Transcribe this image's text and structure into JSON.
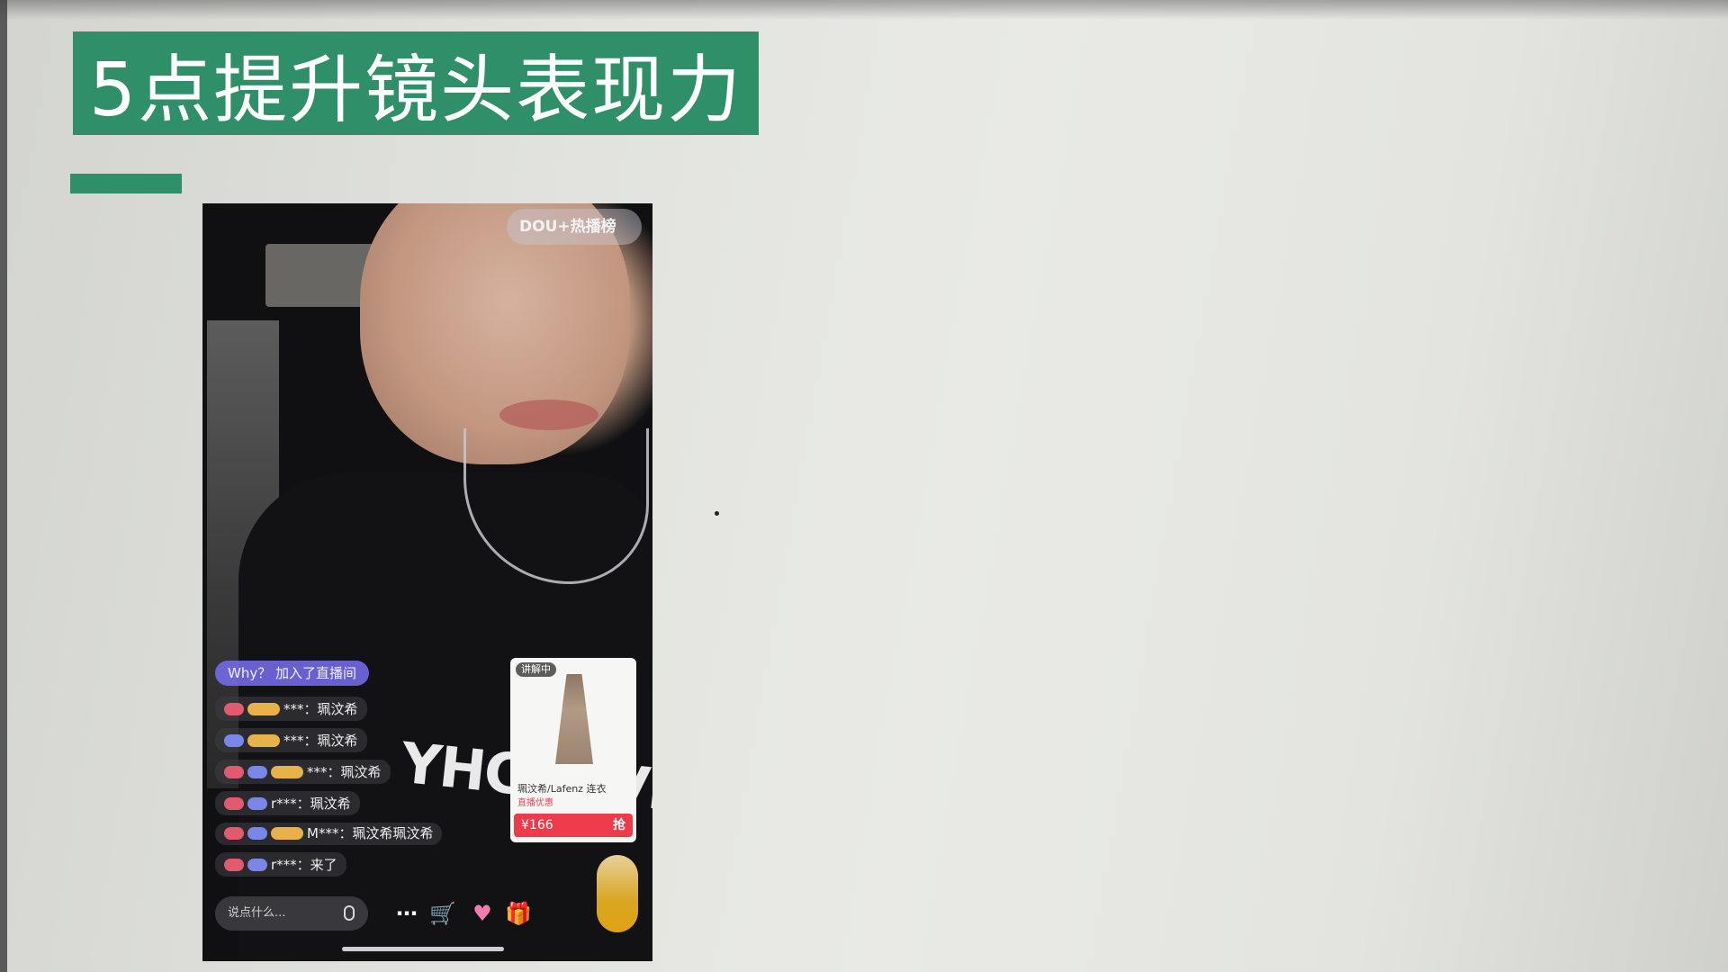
{
  "slide": {
    "title": "5点提升镜头表现力",
    "colors": {
      "accent": "#2f8f69",
      "background": "#e4e5e1"
    }
  },
  "live_stream": {
    "badge": "DOU+热播榜",
    "join_message": "Why？ 加入了直播间",
    "comments": [
      "***：珮汶希",
      "***：珮汶希",
      "***：珮汶希",
      "r***：珮汶希",
      "M***：珮汶希珮汶希",
      "r***：来了"
    ],
    "product": {
      "tag": "讲解中",
      "name": "珮汶希/Lafenz 连衣",
      "subtitle": "直播优惠",
      "price": "¥166",
      "buy_label": "抢"
    },
    "input_placeholder": "说点什么...",
    "shirt_print": "YHCNЭVI",
    "icons": [
      "more-icon",
      "cart-icon",
      "heart-icon",
      "gift-icon",
      "mic-icon"
    ]
  }
}
